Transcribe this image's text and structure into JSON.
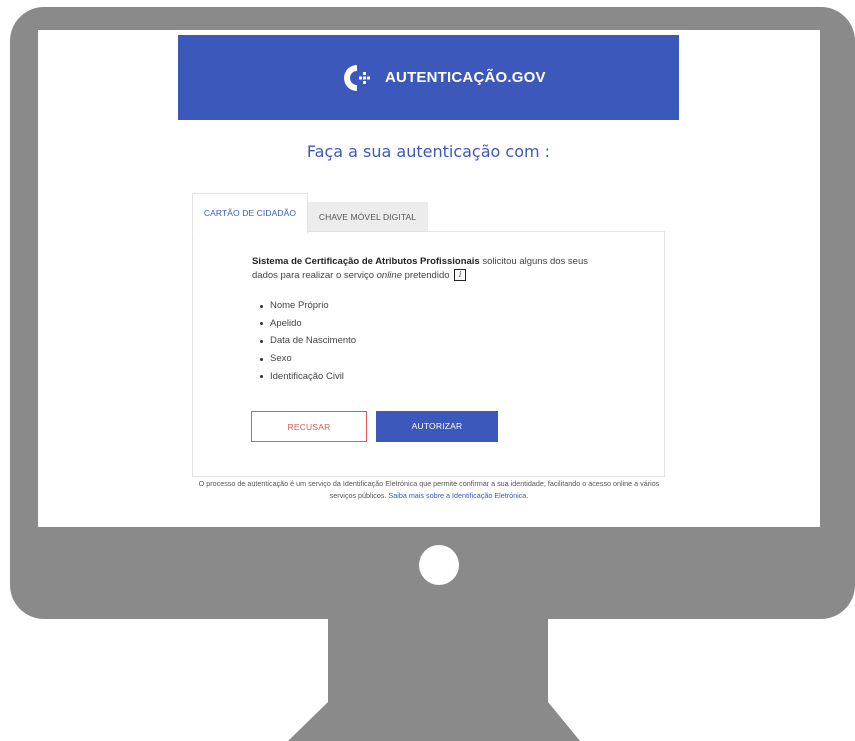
{
  "header": {
    "brand": "AUTENTICAÇÃO.GOV",
    "brand_color": "#3d58bb"
  },
  "heading": "Faça a sua autenticação com :",
  "tabs": [
    {
      "label": "CARTÃO DE CIDADÃO",
      "active": true
    },
    {
      "label": "CHAVE MÓVEL DIGITAL",
      "active": false
    }
  ],
  "request": {
    "service_name": "Sistema de Certificação de Atributos Profissionais",
    "text_part1": "solicitou alguns dos seus dados para realizar o serviço",
    "text_italic": "online",
    "text_part2": "pretendido",
    "info_icon": "i"
  },
  "attributes": [
    "Nome Próprio",
    "Apelido",
    "Data de Nascimento",
    "Sexo",
    "Identificação Civil"
  ],
  "buttons": {
    "refuse": "RECUSAR",
    "authorize": "AUTORIZAR"
  },
  "footer": {
    "text": "O processo de autenticação é um serviço da Identificação Eletrónica que permite confirmar a sua identidade, facilitando o acesso online a vários serviços públicos.",
    "link": "Saiba mais sobre a Identificação Eletrónica."
  },
  "colors": {
    "monitor": "#8a8a8a",
    "refuse": "#e05a5a",
    "accent": "#3d58bb"
  }
}
